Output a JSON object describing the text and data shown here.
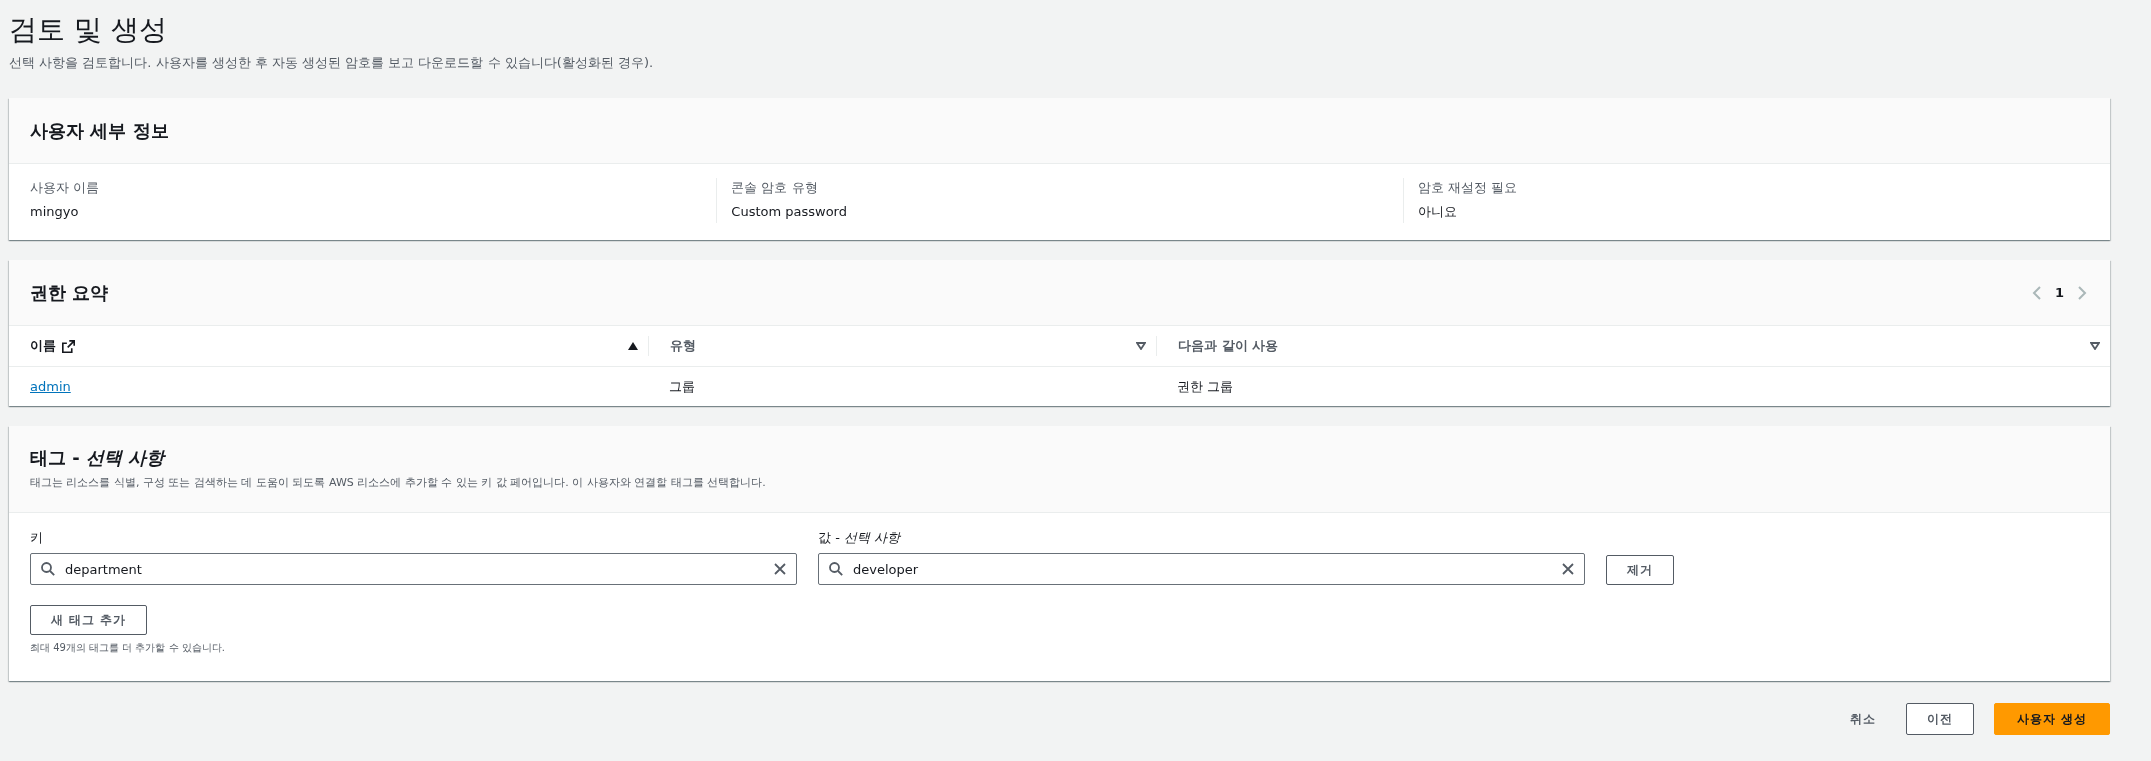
{
  "header": {
    "title": "검토 및 생성",
    "description": "선택 사항을 검토합니다. 사용자를 생성한 후 자동 생성된 암호를 보고 다운로드할 수 있습니다(활성화된 경우)."
  },
  "user_details": {
    "title": "사용자 세부 정보",
    "fields": [
      {
        "label": "사용자 이름",
        "value": "mingyo"
      },
      {
        "label": "콘솔 암호 유형",
        "value": "Custom password"
      },
      {
        "label": "암호 재설정 필요",
        "value": "아니요"
      }
    ]
  },
  "permissions": {
    "title": "권한 요약",
    "page": "1",
    "columns": [
      {
        "label": "이름",
        "external_link": true,
        "sorted": true
      },
      {
        "label": "유형",
        "external_link": false,
        "sorted": false
      },
      {
        "label": "다음과 같이 사용",
        "external_link": false,
        "sorted": false
      }
    ],
    "rows": [
      {
        "name": "admin",
        "type": "그룹",
        "used_as": "권한 그룹"
      }
    ]
  },
  "tags": {
    "title": "태그 - *선택 사항*",
    "description": "태그는 리소스를 식별, 구성 또는 검색하는 데 도움이 되도록 AWS 리소스에 추가할 수 있는 키 값 페어입니다. 이 사용자와 연결할 태그를 선택합니다.",
    "key_label": "키",
    "value_label": "값 - *선택 사항*",
    "items": [
      {
        "key": "department",
        "value": "developer",
        "remove": "제거"
      }
    ],
    "add_button": "새 태그 추가",
    "limit_note": "최대 49개의 태그를 더 추가할 수 있습니다."
  },
  "footer": {
    "cancel": "취소",
    "previous": "이전",
    "create": "사용자 생성"
  }
}
